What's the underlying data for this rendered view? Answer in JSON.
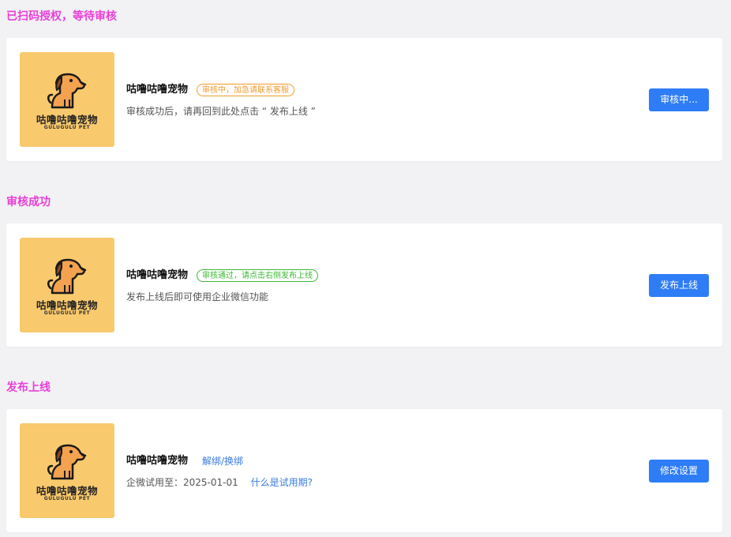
{
  "sections": [
    {
      "title": "已扫码授权，等待审核",
      "card": {
        "logo": {
          "cn": "咕噜咕噜宠物",
          "en": "GULUGULU PET"
        },
        "name": "咕噜咕噜宠物",
        "badge": "审核中，加急请联系客服",
        "badge_color": "#f39a2b",
        "desc": "审核成功后，请再回到此处点击 “ 发布上线 ”",
        "button": "审核中..."
      }
    },
    {
      "title": "审核成功",
      "card": {
        "logo": {
          "cn": "咕噜咕噜宠物",
          "en": "GULUGULU PET"
        },
        "name": "咕噜咕噜宠物",
        "badge": "审核通过，请点击右侧发布上线",
        "badge_color": "#3cb933",
        "desc": "发布上线后即可使用企业微信功能",
        "button": "发布上线"
      }
    },
    {
      "title": "发布上线",
      "card": {
        "logo": {
          "cn": "咕噜咕噜宠物",
          "en": "GULUGULU PET"
        },
        "name": "咕噜咕噜宠物",
        "link": "解绑/换绑",
        "desc": "企微试用至：2025-01-01",
        "desc_link": "什么是试用期?",
        "button": "修改设置"
      }
    }
  ],
  "colors": {
    "section_title": "#e83fd6",
    "button": "#2f7df6",
    "link": "#3a7be0",
    "logo_bg": "#f9c96d"
  }
}
